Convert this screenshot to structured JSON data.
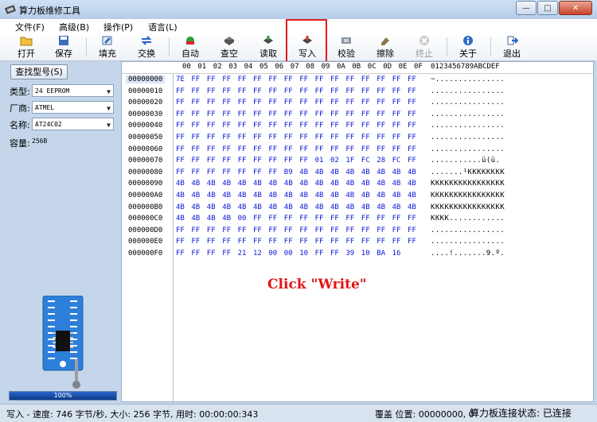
{
  "window": {
    "title": "算力板维修工具",
    "minimize": "—",
    "maximize": "□",
    "close": "✕"
  },
  "menu": [
    "文件(F)",
    "高级(B)",
    "操作(P)",
    "语言(L)"
  ],
  "toolbar": [
    {
      "label": "打开",
      "icon": "folder-open-icon",
      "enabled": true
    },
    {
      "label": "保存",
      "icon": "floppy-icon",
      "enabled": true
    },
    {
      "label": "填充",
      "icon": "fill-icon",
      "enabled": true
    },
    {
      "label": "交换",
      "icon": "swap-icon",
      "enabled": true
    },
    {
      "label": "自动",
      "icon": "auto-icon",
      "enabled": true
    },
    {
      "label": "查空",
      "icon": "blank-check-icon",
      "enabled": true
    },
    {
      "label": "读取",
      "icon": "read-icon",
      "enabled": true
    },
    {
      "label": "写入",
      "icon": "write-icon",
      "enabled": true
    },
    {
      "label": "校验",
      "icon": "verify-icon",
      "enabled": true
    },
    {
      "label": "擦除",
      "icon": "erase-icon",
      "enabled": true
    },
    {
      "label": "终止",
      "icon": "stop-icon",
      "enabled": false
    },
    {
      "label": "关于",
      "icon": "about-icon",
      "enabled": true
    },
    {
      "label": "退出",
      "icon": "exit-icon",
      "enabled": true
    }
  ],
  "left_panel": {
    "lookup_button": "查找型号(S)",
    "type_label": "类型:",
    "type_value": "24 EEPROM",
    "vendor_label": "厂商:",
    "vendor_value": "ATMEL",
    "name_label": "名称:",
    "name_value": "AT24C02",
    "capacity_label": "容量:",
    "capacity_value": "256B",
    "progress_text": "100%",
    "progress_value": 1.0
  },
  "hex": {
    "header_cols": [
      "00",
      "01",
      "02",
      "03",
      "04",
      "05",
      "06",
      "07",
      "08",
      "09",
      "0A",
      "0B",
      "0C",
      "0D",
      "0E",
      "0F"
    ],
    "ascii_header": "0123456789ABCDEF",
    "rows": [
      {
        "addr": "00000000",
        "bytes": [
          "7E",
          "FF",
          "FF",
          "FF",
          "FF",
          "FF",
          "FF",
          "FF",
          "FF",
          "FF",
          "FF",
          "FF",
          "FF",
          "FF",
          "FF",
          "FF"
        ],
        "ascii": "~..............."
      },
      {
        "addr": "00000010",
        "bytes": [
          "FF",
          "FF",
          "FF",
          "FF",
          "FF",
          "FF",
          "FF",
          "FF",
          "FF",
          "FF",
          "FF",
          "FF",
          "FF",
          "FF",
          "FF",
          "FF"
        ],
        "ascii": "................"
      },
      {
        "addr": "00000020",
        "bytes": [
          "FF",
          "FF",
          "FF",
          "FF",
          "FF",
          "FF",
          "FF",
          "FF",
          "FF",
          "FF",
          "FF",
          "FF",
          "FF",
          "FF",
          "FF",
          "FF"
        ],
        "ascii": "................"
      },
      {
        "addr": "00000030",
        "bytes": [
          "FF",
          "FF",
          "FF",
          "FF",
          "FF",
          "FF",
          "FF",
          "FF",
          "FF",
          "FF",
          "FF",
          "FF",
          "FF",
          "FF",
          "FF",
          "FF"
        ],
        "ascii": "................"
      },
      {
        "addr": "00000040",
        "bytes": [
          "FF",
          "FF",
          "FF",
          "FF",
          "FF",
          "FF",
          "FF",
          "FF",
          "FF",
          "FF",
          "FF",
          "FF",
          "FF",
          "FF",
          "FF",
          "FF"
        ],
        "ascii": "................"
      },
      {
        "addr": "00000050",
        "bytes": [
          "FF",
          "FF",
          "FF",
          "FF",
          "FF",
          "FF",
          "FF",
          "FF",
          "FF",
          "FF",
          "FF",
          "FF",
          "FF",
          "FF",
          "FF",
          "FF"
        ],
        "ascii": "................"
      },
      {
        "addr": "00000060",
        "bytes": [
          "FF",
          "FF",
          "FF",
          "FF",
          "FF",
          "FF",
          "FF",
          "FF",
          "FF",
          "FF",
          "FF",
          "FF",
          "FF",
          "FF",
          "FF",
          "FF"
        ],
        "ascii": "................"
      },
      {
        "addr": "00000070",
        "bytes": [
          "FF",
          "FF",
          "FF",
          "FF",
          "FF",
          "FF",
          "FF",
          "FF",
          "FF",
          "01",
          "02",
          "1F",
          "FC",
          "28",
          "FC",
          "FF"
        ],
        "ascii": "...........ü(ü."
      },
      {
        "addr": "00000080",
        "bytes": [
          "FF",
          "FF",
          "FF",
          "FF",
          "FF",
          "FF",
          "FF",
          "B9",
          "4B",
          "4B",
          "4B",
          "4B",
          "4B",
          "4B",
          "4B",
          "4B"
        ],
        "ascii": ".......¹KKKKKKKK"
      },
      {
        "addr": "00000090",
        "bytes": [
          "4B",
          "4B",
          "4B",
          "4B",
          "4B",
          "4B",
          "4B",
          "4B",
          "4B",
          "4B",
          "4B",
          "4B",
          "4B",
          "4B",
          "4B",
          "4B"
        ],
        "ascii": "KKKKKKKKKKKKKKKK"
      },
      {
        "addr": "000000A0",
        "bytes": [
          "4B",
          "4B",
          "4B",
          "4B",
          "4B",
          "4B",
          "4B",
          "4B",
          "4B",
          "4B",
          "4B",
          "4B",
          "4B",
          "4B",
          "4B",
          "4B"
        ],
        "ascii": "KKKKKKKKKKKKKKKK"
      },
      {
        "addr": "000000B0",
        "bytes": [
          "4B",
          "4B",
          "4B",
          "4B",
          "4B",
          "4B",
          "4B",
          "4B",
          "4B",
          "4B",
          "4B",
          "4B",
          "4B",
          "4B",
          "4B",
          "4B"
        ],
        "ascii": "KKKKKKKKKKKKKKKK"
      },
      {
        "addr": "000000C0",
        "bytes": [
          "4B",
          "4B",
          "4B",
          "4B",
          "00",
          "FF",
          "FF",
          "FF",
          "FF",
          "FF",
          "FF",
          "FF",
          "FF",
          "FF",
          "FF",
          "FF"
        ],
        "ascii": "KKKK............"
      },
      {
        "addr": "000000D0",
        "bytes": [
          "FF",
          "FF",
          "FF",
          "FF",
          "FF",
          "FF",
          "FF",
          "FF",
          "FF",
          "FF",
          "FF",
          "FF",
          "FF",
          "FF",
          "FF",
          "FF"
        ],
        "ascii": "................"
      },
      {
        "addr": "000000E0",
        "bytes": [
          "FF",
          "FF",
          "FF",
          "FF",
          "FF",
          "FF",
          "FF",
          "FF",
          "FF",
          "FF",
          "FF",
          "FF",
          "FF",
          "FF",
          "FF",
          "FF"
        ],
        "ascii": "................"
      },
      {
        "addr": "000000F0",
        "bytes": [
          "FF",
          "FF",
          "FF",
          "FF",
          "21",
          "12",
          "00",
          "00",
          "10",
          "FF",
          "FF",
          "39",
          "10",
          "BA",
          "16"
        ],
        "ascii": "....!.......9.º."
      }
    ]
  },
  "annotation": "Click \"Write\"",
  "status": {
    "left": "写入 - 速度: 746 字节/秒, 大小: 256 字节, 用时: 00:00:00:343",
    "mid": "覆盖  位置: 00000000, 0",
    "right": "算力板连接状态: 已连接"
  },
  "colors": {
    "hex_text": "#0a16d8",
    "highlight": "#e01c1c",
    "panel_bg": "#c5d6ea"
  }
}
